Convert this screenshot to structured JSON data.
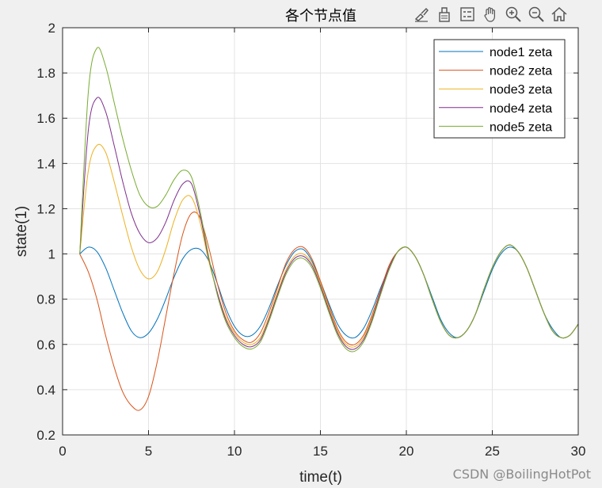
{
  "toolbar": {
    "icons": [
      "brush-icon",
      "data-tip-icon",
      "legend-toggle-icon",
      "pan-hand-icon",
      "zoom-in-icon",
      "zoom-out-icon",
      "home-icon"
    ]
  },
  "watermark": "CSDN @BoilingHotPot",
  "chart_data": {
    "type": "line",
    "title": "各个节点值",
    "xlabel": "time(t)",
    "ylabel": "state(1)",
    "xlim": [
      0,
      30
    ],
    "ylim": [
      0.2,
      2.0
    ],
    "xticks": [
      0,
      5,
      10,
      15,
      20,
      25,
      30
    ],
    "yticks": [
      0.2,
      0.4,
      0.6,
      0.8,
      1.0,
      1.2,
      1.4,
      1.6,
      1.8,
      2.0
    ],
    "ytick_labels": [
      "0.2",
      "0.4",
      "0.6",
      "0.8",
      "1",
      "1.2",
      "1.4",
      "1.6",
      "1.8",
      "2"
    ],
    "grid": true,
    "legend_position": "top-right",
    "x": [
      1,
      1.5,
      2,
      2.5,
      3,
      3.5,
      4,
      4.5,
      5,
      5.5,
      6,
      6.5,
      7,
      7.5,
      8,
      8.5,
      9,
      9.5,
      10,
      10.5,
      11,
      11.5,
      12,
      12.5,
      13,
      13.5,
      14,
      14.5,
      15,
      15.5,
      16,
      16.5,
      17,
      17.5,
      18,
      18.5,
      19,
      19.5,
      20,
      20.5,
      21,
      21.5,
      22,
      22.5,
      23,
      23.5,
      24,
      24.5,
      25,
      25.5,
      26,
      26.5,
      27,
      27.5,
      28,
      28.5,
      29,
      29.5,
      30
    ],
    "series": [
      {
        "name": "node1 zeta",
        "color": "#0072BD",
        "values": [
          1.0,
          1.03,
          1.01,
          0.94,
          0.84,
          0.74,
          0.66,
          0.63,
          0.65,
          0.71,
          0.8,
          0.9,
          0.98,
          1.02,
          1.02,
          0.97,
          0.87,
          0.76,
          0.68,
          0.64,
          0.64,
          0.68,
          0.76,
          0.86,
          0.95,
          1.01,
          1.02,
          0.97,
          0.88,
          0.78,
          0.69,
          0.64,
          0.63,
          0.67,
          0.75,
          0.85,
          0.94,
          1.01,
          1.03,
          0.99,
          0.91,
          0.81,
          0.71,
          0.65,
          0.63,
          0.66,
          0.73,
          0.83,
          0.93,
          1.0,
          1.03,
          1.01,
          0.94,
          0.84,
          0.74,
          0.67,
          0.63,
          0.64,
          0.69
        ]
      },
      {
        "name": "node2 zeta",
        "color": "#D95319",
        "values": [
          1.0,
          0.92,
          0.8,
          0.64,
          0.5,
          0.39,
          0.33,
          0.31,
          0.37,
          0.52,
          0.72,
          0.92,
          1.09,
          1.18,
          1.16,
          1.03,
          0.87,
          0.74,
          0.66,
          0.62,
          0.61,
          0.65,
          0.74,
          0.85,
          0.96,
          1.02,
          1.03,
          0.98,
          0.88,
          0.77,
          0.67,
          0.61,
          0.6,
          0.64,
          0.73,
          0.84,
          0.95,
          1.01,
          1.03,
          0.99,
          0.91,
          0.8,
          0.7,
          0.64,
          0.63,
          0.66,
          0.73,
          0.84,
          0.94,
          1.01,
          1.04,
          1.01,
          0.94,
          0.84,
          0.74,
          0.66,
          0.63,
          0.64,
          0.69
        ]
      },
      {
        "name": "node3 zeta",
        "color": "#EDB120",
        "values": [
          1.0,
          1.37,
          1.48,
          1.45,
          1.32,
          1.17,
          1.03,
          0.93,
          0.89,
          0.92,
          1.02,
          1.15,
          1.24,
          1.25,
          1.14,
          0.97,
          0.83,
          0.72,
          0.65,
          0.61,
          0.6,
          0.63,
          0.72,
          0.83,
          0.93,
          0.99,
          1.0,
          0.96,
          0.87,
          0.76,
          0.66,
          0.6,
          0.59,
          0.63,
          0.72,
          0.83,
          0.94,
          1.01,
          1.03,
          0.99,
          0.91,
          0.8,
          0.7,
          0.64,
          0.63,
          0.66,
          0.73,
          0.84,
          0.94,
          1.01,
          1.04,
          1.01,
          0.94,
          0.84,
          0.74,
          0.66,
          0.63,
          0.64,
          0.69
        ]
      },
      {
        "name": "node4 zeta",
        "color": "#7E2F8E",
        "values": [
          1.0,
          1.55,
          1.69,
          1.63,
          1.48,
          1.32,
          1.18,
          1.09,
          1.05,
          1.07,
          1.14,
          1.24,
          1.31,
          1.31,
          1.17,
          0.98,
          0.83,
          0.71,
          0.64,
          0.6,
          0.59,
          0.62,
          0.71,
          0.82,
          0.92,
          0.98,
          0.99,
          0.95,
          0.86,
          0.75,
          0.65,
          0.59,
          0.58,
          0.62,
          0.71,
          0.83,
          0.94,
          1.01,
          1.03,
          0.99,
          0.91,
          0.8,
          0.7,
          0.64,
          0.63,
          0.66,
          0.73,
          0.84,
          0.94,
          1.01,
          1.04,
          1.01,
          0.94,
          0.84,
          0.74,
          0.66,
          0.63,
          0.64,
          0.69
        ]
      },
      {
        "name": "node5 zeta",
        "color": "#77AC30",
        "values": [
          1.0,
          1.72,
          1.91,
          1.83,
          1.67,
          1.51,
          1.37,
          1.26,
          1.21,
          1.21,
          1.26,
          1.33,
          1.37,
          1.34,
          1.19,
          0.99,
          0.82,
          0.7,
          0.63,
          0.59,
          0.58,
          0.61,
          0.7,
          0.81,
          0.91,
          0.97,
          0.98,
          0.94,
          0.85,
          0.74,
          0.64,
          0.58,
          0.57,
          0.61,
          0.7,
          0.82,
          0.93,
          1.01,
          1.03,
          0.99,
          0.91,
          0.8,
          0.7,
          0.64,
          0.63,
          0.66,
          0.73,
          0.84,
          0.94,
          1.01,
          1.04,
          1.01,
          0.94,
          0.84,
          0.74,
          0.66,
          0.63,
          0.64,
          0.69
        ]
      }
    ]
  }
}
